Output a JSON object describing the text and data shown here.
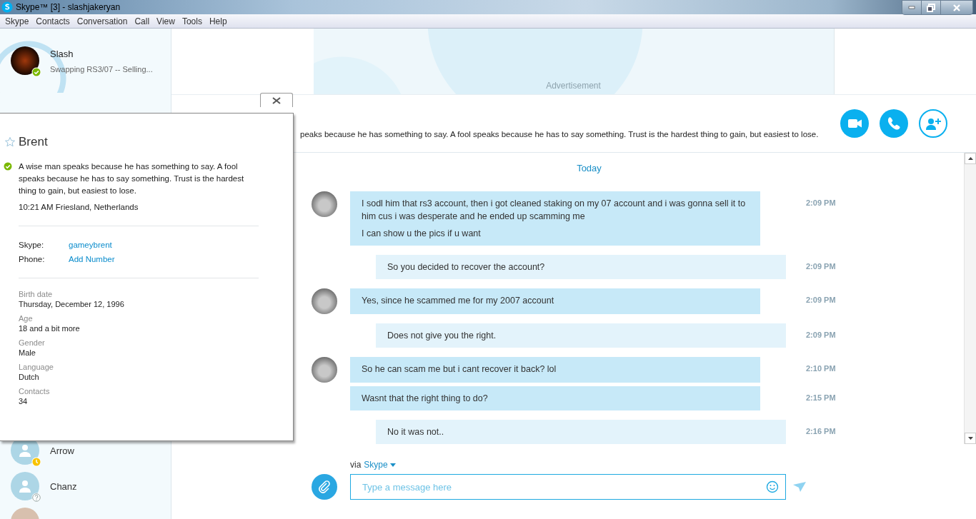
{
  "window": {
    "title": "Skype™ [3] - slashjakeryan"
  },
  "menu": [
    "Skype",
    "Contacts",
    "Conversation",
    "Call",
    "View",
    "Tools",
    "Help"
  ],
  "profile": {
    "name": "Slash",
    "mood": "Swapping RS3/07 -- Selling...",
    "online": true
  },
  "contacts": [
    {
      "name": "Arrow",
      "kind": "away"
    },
    {
      "name": "Chanz",
      "kind": "unknown"
    },
    {
      "kind": "photo"
    }
  ],
  "advertisement": {
    "label": "Advertisement"
  },
  "conversation": {
    "mood": "peaks because he has something to say. A fool speaks because he has to say something. Trust is the hardest thing to gain, but easiest to lose.",
    "day": "Today",
    "messages": [
      {
        "kind": "incoming",
        "avatar": true,
        "paragraphs": [
          "I sodl him that rs3 account, then i got cleaned staking on my 07 account and i was gonna sell it to him cus i was desperate and he ended up scamming me",
          "I can show u the pics if u want"
        ],
        "time": "2:09 PM"
      },
      {
        "kind": "outgoing",
        "avatar": false,
        "paragraphs": [
          "So you decided to recover the account?"
        ],
        "time": "2:09 PM"
      },
      {
        "kind": "incoming",
        "avatar": true,
        "paragraphs": [
          "Yes, since he scammed me for my 2007 account"
        ],
        "time": "2:09 PM"
      },
      {
        "kind": "outgoing",
        "avatar": false,
        "paragraphs": [
          "Does not give you the right."
        ],
        "time": "2:09 PM"
      },
      {
        "kind": "incoming",
        "avatar": true,
        "paragraphs": [
          "So he can scam me but i cant recover it back? lol"
        ],
        "time": "2:10 PM"
      },
      {
        "kind": "incoming",
        "avatar": false,
        "paragraphs": [
          "Wasnt that the right thing to do?"
        ],
        "time": "2:15 PM"
      },
      {
        "kind": "outgoing",
        "avatar": false,
        "paragraphs": [
          "No it was not.."
        ],
        "time": "2:16 PM"
      }
    ]
  },
  "compose": {
    "via": "via",
    "service": "Skype",
    "placeholder": "Type a message here"
  },
  "profile_card": {
    "name": "Brent",
    "favorite": false,
    "online": true,
    "mood": "A wise man speaks because he has something to say. A fool speaks because he has to say something. Trust is the hardest thing to gain, but easiest to lose.",
    "local_time": "10:21 AM Friesland, Netherlands",
    "accounts": [
      {
        "label": "Skype:",
        "value": "gameybrent"
      },
      {
        "label": "Phone:",
        "value": "Add Number"
      }
    ],
    "details": [
      {
        "label": "Birth date",
        "value": "Thursday, December 12, 1996"
      },
      {
        "label": "Age",
        "value": "18 and a bit more"
      },
      {
        "label": "Gender",
        "value": "Male"
      },
      {
        "label": "Language",
        "value": "Dutch"
      },
      {
        "label": "Contacts",
        "value": "34"
      }
    ]
  }
}
